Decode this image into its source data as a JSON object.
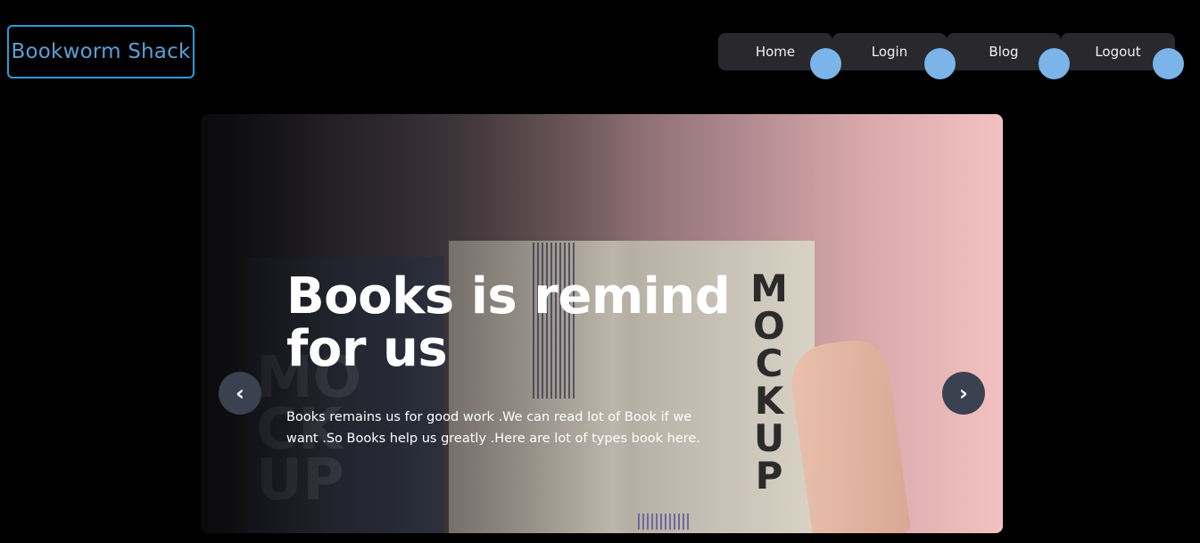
{
  "brand": {
    "name": "Bookworm Shack"
  },
  "nav": {
    "items": [
      {
        "label": "Home"
      },
      {
        "label": "Login"
      },
      {
        "label": "Blog"
      },
      {
        "label": "Logout"
      }
    ]
  },
  "carousel": {
    "heading": "Books is remind for us",
    "text": "Books remains us for good work .We can read lot of Book if we want .So Books help us greatly .Here are lot of types book here.",
    "prev_icon": "‹",
    "next_icon": "›",
    "image_text": {
      "mockup": "MOCKUP",
      "cover": "MOCKUP"
    }
  },
  "colors": {
    "brand_border": "#2d9bd8",
    "brand_text": "#5aa0d6",
    "nav_button": "#28282d",
    "nav_dot": "#7ab4e8",
    "arrow_bg": "#3a4150",
    "background": "#000000"
  }
}
